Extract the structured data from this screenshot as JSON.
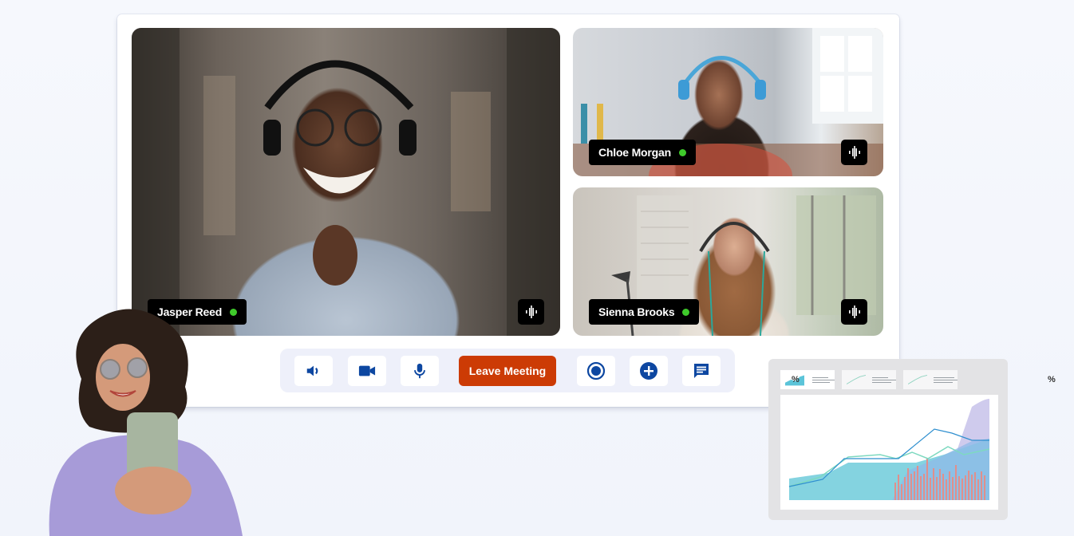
{
  "meeting": {
    "participants": [
      {
        "name": "Jasper Reed",
        "status": "online",
        "status_color": "#3fca2b"
      },
      {
        "name": "Chloe Morgan",
        "status": "online",
        "status_color": "#3fca2b"
      },
      {
        "name": "Sienna Brooks",
        "status": "online",
        "status_color": "#3fca2b"
      }
    ],
    "audio_indicator_icon": "audio-waveform-icon"
  },
  "toolbar": {
    "speaker_icon": "speaker-icon",
    "camera_icon": "video-camera-icon",
    "mic_icon": "microphone-icon",
    "leave_label": "Leave Meeting",
    "record_icon": "record-icon",
    "add_icon": "add-circle-icon",
    "chat_icon": "chat-icon",
    "icon_color": "#0d47a1",
    "leave_color": "#cc3b05"
  },
  "dashboard": {
    "kpi_cards": [
      {
        "symbol": "%",
        "active": true
      },
      {
        "symbol": "%",
        "active": false
      },
      {
        "symbol": "%",
        "active": false
      }
    ]
  }
}
